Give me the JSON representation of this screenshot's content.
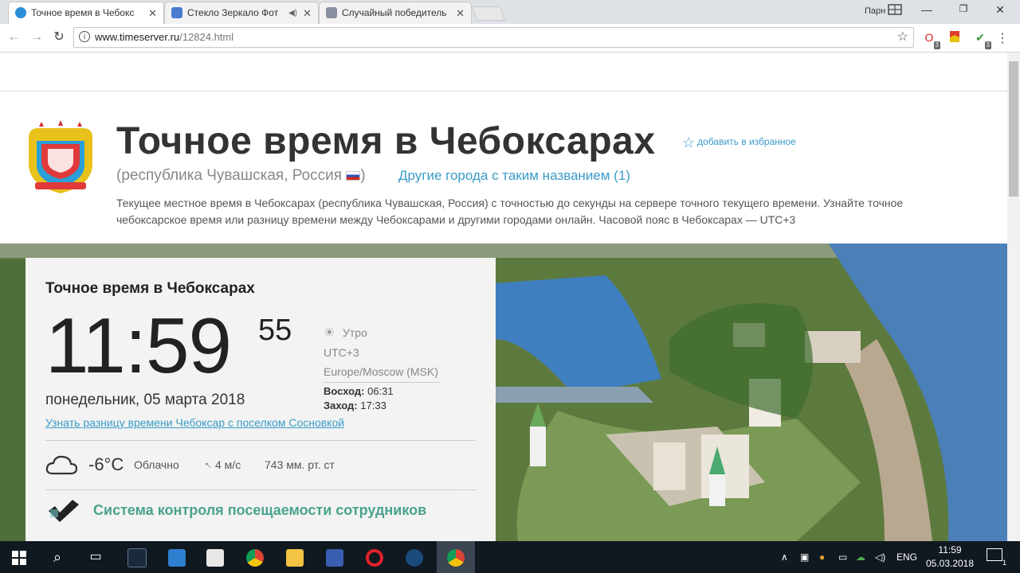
{
  "browser": {
    "tabs": [
      {
        "title": "Точное время в Чебокс",
        "favicon_color": "#2c8fd6"
      },
      {
        "title": "Стекло Зеркало Фот",
        "favicon_color": "#4a7bd0"
      },
      {
        "title": "Случайный победитель",
        "favicon_color": "#8a8fa0"
      }
    ],
    "profile_label": "Парн",
    "address": {
      "domain": "www.timeserver.ru",
      "path": "/12824.html"
    },
    "ext_badges": [
      "3",
      "3"
    ]
  },
  "header": {
    "title": "Точное время в Чебоксарах",
    "add_favorite": "добавить в избранное",
    "subtitle": "(республика Чувашская, Россия",
    "subtitle_close": ")",
    "other_cities": "Другие города с таким названием (1)",
    "description": "Текущее местное время в Чебоксарах (республика Чувашская, Россия) с точностью до секунды на сервере точного текущего времени. Узнайте точное чебоксарское время или разницу времени между Чебоксарами и другими городами онлайн. Часовой пояс в Чебоксарах — UTC+3"
  },
  "widget": {
    "title": "Точное время в Чебоксарах",
    "time": "11:59",
    "seconds": "55",
    "daypart": "Утро",
    "utc": "UTC+3",
    "timezone": "Europe/Moscow (MSK)",
    "sunrise_label": "Восход:",
    "sunrise": "06:31",
    "sunset_label": "Заход:",
    "sunset": "17:33",
    "date": "понедельник, 05 марта 2018",
    "diff_link": "Узнать разницу времени Чебоксар с поселком Сосновкой",
    "weather": {
      "temp": "-6°C",
      "condition": "Облачно",
      "wind": "4 м/с",
      "pressure": "743 мм. рт. ст"
    },
    "promo": "Система контроля посещаемости сотрудников"
  },
  "taskbar": {
    "lang": "ENG",
    "time": "11:59",
    "date": "05.03.2018",
    "notifications": "1"
  }
}
